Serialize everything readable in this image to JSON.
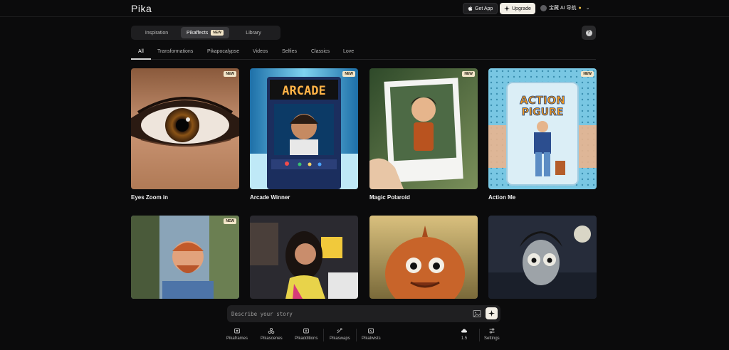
{
  "header": {
    "logo": "Pika",
    "get_app": "Get App",
    "upgrade": "Upgrade",
    "user_name": "宝藏 AI 导航"
  },
  "main_tabs": [
    {
      "label": "Inspiration"
    },
    {
      "label": "Pikaffects",
      "badge": "NEW"
    },
    {
      "label": "Library"
    }
  ],
  "help_label": "?",
  "categories": [
    "All",
    "Transformations",
    "Pikapocalypse",
    "Videos",
    "Selfies",
    "Classics",
    "Love"
  ],
  "cards": [
    {
      "caption": "Eyes Zoom in",
      "badge": "NEW"
    },
    {
      "caption": "Arcade Winner",
      "badge": "NEW",
      "art_text": "ARCADE"
    },
    {
      "caption": "Magic Polaroid",
      "badge": "NEW"
    },
    {
      "caption": "Action Me",
      "badge": "NEW",
      "art_text_1": "ACTION",
      "art_text_2": "PIGURE"
    },
    {
      "caption": "",
      "badge": "NEW"
    },
    {
      "caption": "",
      "badge": ""
    },
    {
      "caption": "",
      "badge": ""
    },
    {
      "caption": "",
      "badge": ""
    }
  ],
  "prompt": {
    "placeholder": "Describe your story"
  },
  "tools": [
    {
      "label": "Pikaframes",
      "icon": "frames-icon"
    },
    {
      "label": "Pikascenes",
      "icon": "scenes-icon"
    },
    {
      "label": "Pikadditions",
      "icon": "additions-icon"
    },
    {
      "label": "Pikaswaps",
      "icon": "swaps-icon"
    },
    {
      "label": "Pikatwists",
      "icon": "twists-icon"
    },
    {
      "label": "1.5",
      "icon": "cloud-icon"
    },
    {
      "label": "Settings",
      "icon": "settings-icon"
    }
  ],
  "colors": {
    "background": "#0b0b0c",
    "badge": "#f3e6c9",
    "upgrade": "#f3efe6",
    "accent_dot": "#f5c445"
  }
}
